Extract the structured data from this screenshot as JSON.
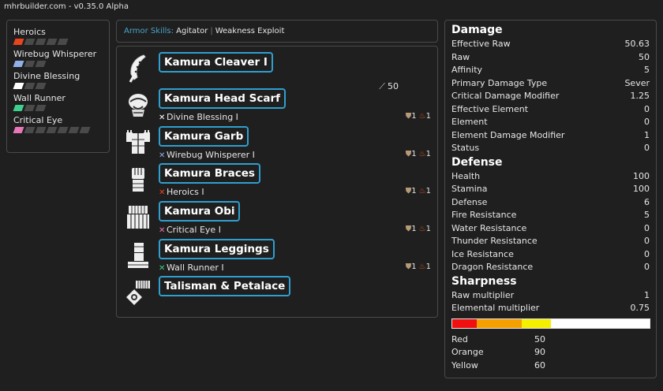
{
  "app_title": "mhrbuilder.com - v0.35.0 Alpha",
  "skills": [
    {
      "name": "Heroics",
      "color": "#e8451e",
      "level": 1,
      "max": 5
    },
    {
      "name": "Wirebug Whisperer",
      "color": "#8fb0e8",
      "level": 1,
      "max": 3
    },
    {
      "name": "Divine Blessing",
      "color": "#ffffff",
      "level": 1,
      "max": 3
    },
    {
      "name": "Wall Runner",
      "color": "#3ecf8e",
      "level": 1,
      "max": 3
    },
    {
      "name": "Critical Eye",
      "color": "#e877b8",
      "level": 1,
      "max": 7
    }
  ],
  "armor_skills": {
    "label": "Armor Skills:",
    "items": [
      "Agitator",
      "Weakness Exploit"
    ]
  },
  "equipment": [
    {
      "name": "Kamura Cleaver I",
      "icon": "greatsword-icon",
      "attack": "50",
      "skill": null,
      "slots": null
    },
    {
      "name": "Kamura Head Scarf",
      "icon": "helm-icon",
      "skill": "Divine Blessing I",
      "skill_color": "#ffffff",
      "def": "1",
      "fire": "1"
    },
    {
      "name": "Kamura Garb",
      "icon": "chest-icon",
      "skill": "Wirebug Whisperer I",
      "skill_color": "#8fb0e8",
      "def": "1",
      "fire": "1"
    },
    {
      "name": "Kamura Braces",
      "icon": "arms-icon",
      "skill": "Heroics I",
      "skill_color": "#e8451e",
      "def": "1",
      "fire": "1"
    },
    {
      "name": "Kamura Obi",
      "icon": "waist-icon",
      "skill": "Critical Eye I",
      "skill_color": "#e877b8",
      "def": "1",
      "fire": "1"
    },
    {
      "name": "Kamura Leggings",
      "icon": "legs-icon",
      "skill": "Wall Runner I",
      "skill_color": "#3ecf8e",
      "def": "1",
      "fire": "1"
    },
    {
      "name": "Talisman & Petalace",
      "icon": "talisman-icon",
      "skill": null,
      "slots": null
    }
  ],
  "stats": {
    "damage_title": "Damage",
    "damage": [
      {
        "label": "Effective Raw",
        "value": "50.63"
      },
      {
        "label": "Raw",
        "value": "50"
      },
      {
        "label": "Affinity",
        "value": "5"
      },
      {
        "label": "Primary Damage Type",
        "value": "Sever"
      },
      {
        "label": "Critical Damage Modifier",
        "value": "1.25"
      },
      {
        "label": "Effective Element",
        "value": "0"
      },
      {
        "label": "Element",
        "value": "0"
      },
      {
        "label": "Element Damage Modifier",
        "value": "1"
      },
      {
        "label": "Status",
        "value": "0"
      }
    ],
    "defense_title": "Defense",
    "defense": [
      {
        "label": "Health",
        "value": "100"
      },
      {
        "label": "Stamina",
        "value": "100"
      },
      {
        "label": "Defense",
        "value": "6"
      },
      {
        "label": "Fire Resistance",
        "value": "5"
      },
      {
        "label": "Water Resistance",
        "value": "0"
      },
      {
        "label": "Thunder Resistance",
        "value": "0"
      },
      {
        "label": "Ice Resistance",
        "value": "0"
      },
      {
        "label": "Dragon Resistance",
        "value": "0"
      }
    ],
    "sharpness_title": "Sharpness",
    "sharpness_mods": [
      {
        "label": "Raw multiplier",
        "value": "1"
      },
      {
        "label": "Elemental multiplier",
        "value": "0.75"
      }
    ],
    "sharpness": [
      {
        "label": "Red",
        "value": "50",
        "color": "#f01010"
      },
      {
        "label": "Orange",
        "value": "90",
        "color": "#f5a000"
      },
      {
        "label": "Yellow",
        "value": "60",
        "color": "#f5ef00"
      }
    ],
    "sharpness_max": 400
  }
}
